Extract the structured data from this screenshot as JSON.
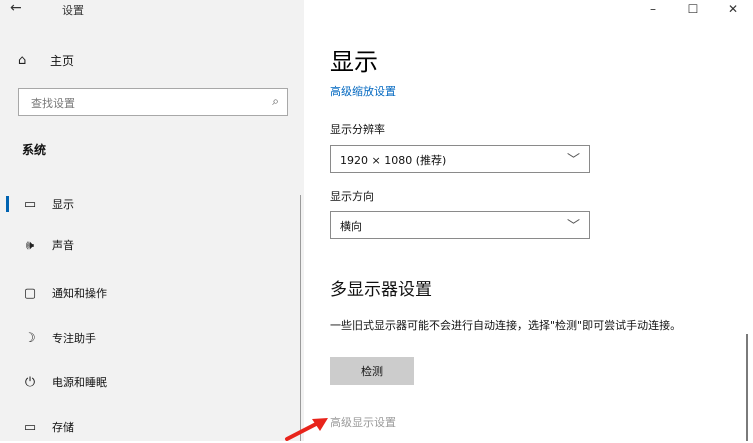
{
  "window": {
    "title": "设置",
    "controls": {
      "minimize": "–",
      "maximize": "☐",
      "close": "✕"
    }
  },
  "sidebar": {
    "back": "←",
    "home": {
      "icon": "⌂",
      "label": "主页"
    },
    "search": {
      "placeholder": "查找设置",
      "value": "",
      "icon": "⌕"
    },
    "section": "系统",
    "items": [
      {
        "icon": "▭",
        "label": "显示",
        "selected": true
      },
      {
        "icon": "🕪",
        "label": "声音",
        "selected": false
      },
      {
        "icon": "▢",
        "label": "通知和操作",
        "selected": false
      },
      {
        "icon": "☽",
        "label": "专注助手",
        "selected": false
      },
      {
        "icon": "⏻",
        "label": "电源和睡眠",
        "selected": false
      },
      {
        "icon": "▭",
        "label": "存储",
        "selected": false
      }
    ]
  },
  "main": {
    "title": "显示",
    "advanced_scaling_link": "高级缩放设置",
    "resolution": {
      "label": "显示分辨率",
      "value": "1920 × 1080 (推荐)"
    },
    "orientation": {
      "label": "显示方向",
      "value": "横向"
    },
    "multi_display": {
      "title": "多显示器设置",
      "description": "一些旧式显示器可能不会进行自动连接，选择\"检测\"即可尝试手动连接。",
      "detect_button": "检测"
    },
    "advanced_display_link": "高级显示设置"
  },
  "colors": {
    "accent": "#0063b1",
    "link": "#0067c0",
    "sidebar_bg": "#f2f2f2",
    "annotation_arrow": "#e8241b"
  }
}
